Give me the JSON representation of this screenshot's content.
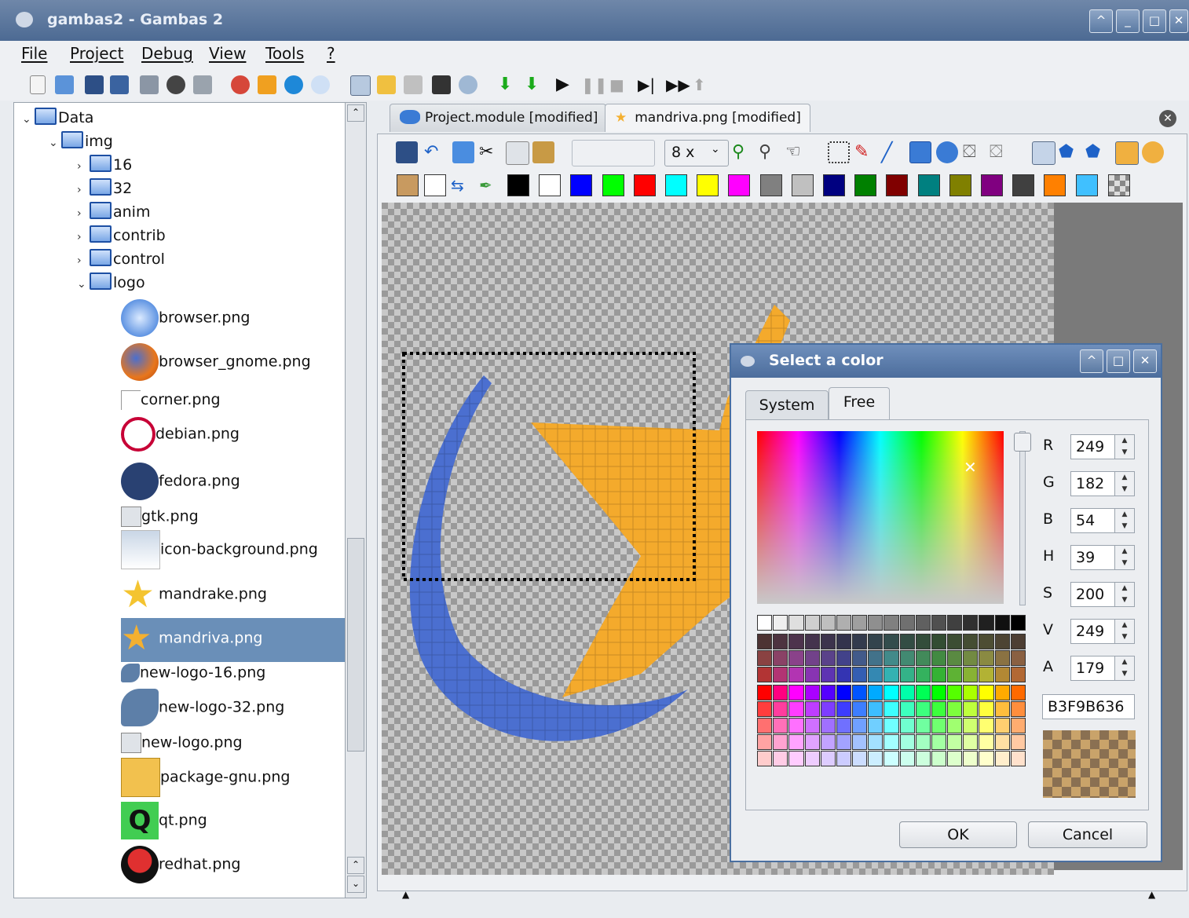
{
  "window": {
    "title": "gambas2 - Gambas 2"
  },
  "menu": [
    "File",
    "Project",
    "Debug",
    "View",
    "Tools",
    "?"
  ],
  "tree": {
    "folders": [
      {
        "label": "Data",
        "expanded": true
      },
      {
        "label": "img",
        "expanded": true
      },
      {
        "label": "16",
        "expanded": false
      },
      {
        "label": "32",
        "expanded": false
      },
      {
        "label": "anim",
        "expanded": false
      },
      {
        "label": "contrib",
        "expanded": false
      },
      {
        "label": "control",
        "expanded": false
      },
      {
        "label": "logo",
        "expanded": true
      }
    ],
    "files": [
      {
        "label": "browser.png",
        "icon": "globe-icon"
      },
      {
        "label": "browser_gnome.png",
        "icon": "firefox-icon"
      },
      {
        "label": "corner.png",
        "icon": "corner-icon"
      },
      {
        "label": "debian.png",
        "icon": "debian-swirl-icon"
      },
      {
        "label": "fedora.png",
        "icon": "fedora-icon"
      },
      {
        "label": "gtk.png",
        "icon": "image-file-icon"
      },
      {
        "label": "icon-background.png",
        "icon": "window-background-icon"
      },
      {
        "label": "mandrake.png",
        "icon": "yellow-star-icon"
      },
      {
        "label": "mandriva.png",
        "icon": "mandriva-star-icon",
        "selected": true
      },
      {
        "label": "new-logo-16.png",
        "icon": "shrimp-logo-icon"
      },
      {
        "label": "new-logo-32.png",
        "icon": "shrimp-logo-icon"
      },
      {
        "label": "new-logo.png",
        "icon": "image-file-icon"
      },
      {
        "label": "package-gnu.png",
        "icon": "gnu-package-icon"
      },
      {
        "label": "qt.png",
        "icon": "qt-logo-icon"
      },
      {
        "label": "redhat.png",
        "icon": "redhat-logo-icon"
      }
    ]
  },
  "editor": {
    "tabs": [
      {
        "label": "Project.module [modified]",
        "active": false
      },
      {
        "label": "mandriva.png [modified]",
        "active": true
      }
    ],
    "zoom": "8 x",
    "palette": [
      "#000000",
      "#ffffff",
      "#0000ff",
      "#00ff00",
      "#ff0000",
      "#00ffff",
      "#ffff00",
      "#ff00ff",
      "#808080",
      "#c0c0c0",
      "#000080",
      "#008000",
      "#800000",
      "#008080",
      "#808000",
      "#800080",
      "#404040",
      "#ff8000",
      "#40c0ff"
    ]
  },
  "color_dialog": {
    "title": "Select a color",
    "tabs": [
      "System",
      "Free"
    ],
    "active_tab": "Free",
    "fields": [
      {
        "label": "R",
        "value": "249"
      },
      {
        "label": "G",
        "value": "182"
      },
      {
        "label": "B",
        "value": "54"
      },
      {
        "label": "H",
        "value": "39"
      },
      {
        "label": "S",
        "value": "200"
      },
      {
        "label": "V",
        "value": "249"
      },
      {
        "label": "A",
        "value": "179"
      }
    ],
    "hex": "B3F9B636",
    "ok": "OK",
    "cancel": "Cancel",
    "selected_color": "#f9b636"
  }
}
